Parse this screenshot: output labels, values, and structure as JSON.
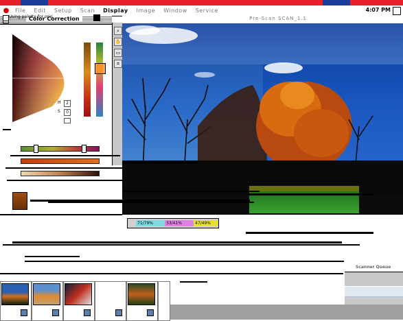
{
  "menubar": {
    "apple": "",
    "items": [
      {
        "label": "File",
        "bold": false
      },
      {
        "label": "Edit",
        "bold": false
      },
      {
        "label": "Setup",
        "bold": false
      },
      {
        "label": "Scan",
        "bold": false
      },
      {
        "label": "Display",
        "bold": true
      },
      {
        "label": "Image",
        "bold": false
      },
      {
        "label": "Window",
        "bold": false
      },
      {
        "label": "Service",
        "bold": false
      }
    ],
    "clock": "4:07 PM"
  },
  "color_correction": {
    "title": "Color Correction",
    "palette_label": "Using palette for orig",
    "field1_label": "H",
    "field2_label": "S",
    "field1_value": "2",
    "field2_value": "0"
  },
  "image_window": {
    "title": "Pre-Scan SCAN_1.1"
  },
  "info_bar": {
    "field1": "71/79%",
    "field2": "33/41%",
    "field3": "47/49%"
  },
  "right_panel": {
    "title": "Scanner Queue"
  },
  "colors": {
    "accent_red": "#e8202a",
    "sky_blue": "#2a6ac8",
    "foliage_orange": "#d86a10"
  }
}
